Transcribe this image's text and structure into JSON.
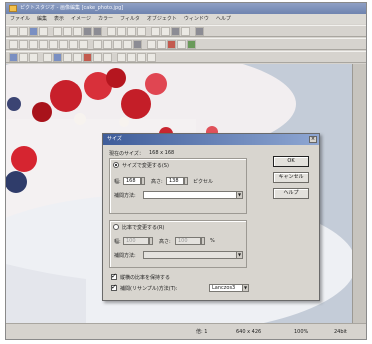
{
  "window": {
    "title": "ピクトスタジオ - 画像編集 [cake_photo.jpg]"
  },
  "menu": [
    "ファイル",
    "編集",
    "表示",
    "イメージ",
    "カラー",
    "フィルタ",
    "オブジェクト",
    "ウィンドウ",
    "ヘルプ"
  ],
  "dialog": {
    "title": "サイズ",
    "current_size_label": "現在のサイズ：",
    "current_size_value": "168 x 168",
    "group1": {
      "label": "サイズで変更する(S)",
      "width_label": "幅:",
      "width_value": "168",
      "height_label": "高さ:",
      "height_value": "138",
      "unit": "ピクセル",
      "interp_label": "補間方法:"
    },
    "group2": {
      "label": "比率で変更する(R)",
      "width_label": "幅:",
      "width_value": "100",
      "height_label": "高さ:",
      "height_value": "100",
      "unit": "%",
      "interp_label": "補間方法:"
    },
    "keep_ratio_label": "縦横の比率を保持する",
    "resample_label": "補間(リサンプル)方法(T):",
    "resample_value": "Lanczos3",
    "ok_label": "OK",
    "cancel_label": "キャンセル",
    "help_label": "ヘルプ"
  },
  "status": {
    "scale": "倍: 1",
    "size": "640 x 426",
    "zoom": "100%",
    "mode": "24bit"
  }
}
